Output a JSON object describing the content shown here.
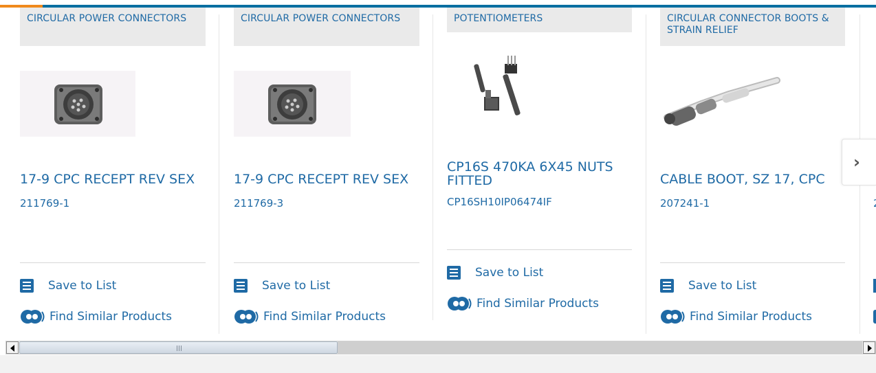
{
  "cards": [
    {
      "category": "CIRCULAR POWER CONNECTORS",
      "title": "17-9 CPC RECEPT REV SEX",
      "part_number": "211769-1",
      "image": "circular-receptacle-connector"
    },
    {
      "category": "CIRCULAR POWER CONNECTORS",
      "title": "17-9 CPC RECEPT REV SEX",
      "part_number": "211769-3",
      "image": "circular-receptacle-connector"
    },
    {
      "category": "POTENTIOMETERS",
      "title": "CP16S 470KA 6X45 NUTS FITTED",
      "part_number": "CP16SH10IP06474IF",
      "image": "potentiometer"
    },
    {
      "category": "CIRCULAR CONNECTOR BOOTS & STRAIN RELIEF",
      "title": "CABLE BOOT, SZ 17, CPC",
      "part_number": "207241-1",
      "image": "cable-boot"
    },
    {
      "category": "",
      "title": "",
      "part_number": "2",
      "image": ""
    }
  ],
  "actions": {
    "save_label": "Save to List",
    "find_label": "Find Similar Products"
  },
  "nav": {
    "next_icon": "chevron-right-icon"
  },
  "colors": {
    "accent": "#f08a1c",
    "brand": "#006ea1",
    "link": "#1f6aa5"
  }
}
